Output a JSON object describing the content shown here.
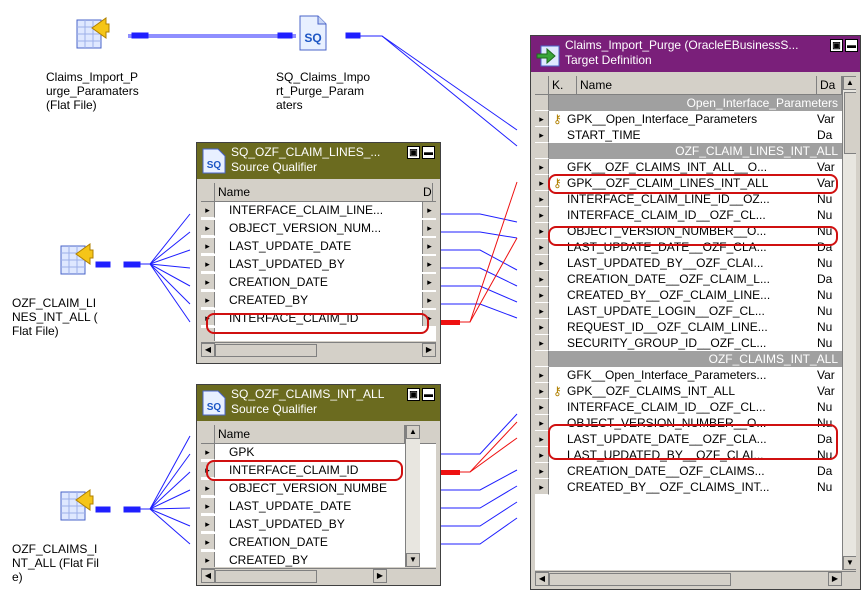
{
  "sources": [
    {
      "label": "Claims_Import_P\nurge_Paramaters\n(Flat File)"
    },
    {
      "label": "OZF_CLAIM_LI\nNES_INT_ALL (\nFlat File)"
    },
    {
      "label": "OZF_CLAIMS_I\nNT_ALL (Flat Fil\ne)"
    }
  ],
  "sq_params": {
    "label": "SQ_Claims_Impo\nrt_Purge_Param\naters",
    "icon": "SQ"
  },
  "sq_lines": {
    "title": "SQ_OZF_CLAIM_LINES_...",
    "subtitle": "Source Qualifier",
    "col_name": "Name",
    "col_type": "D",
    "rows": [
      {
        "name": "INTERFACE_CLAIM_LINE...",
        "type": "d"
      },
      {
        "name": "OBJECT_VERSION_NUM...",
        "type": "d"
      },
      {
        "name": "LAST_UPDATE_DATE",
        "type": "d"
      },
      {
        "name": "LAST_UPDATED_BY",
        "type": "d"
      },
      {
        "name": "CREATION_DATE",
        "type": "d"
      },
      {
        "name": "CREATED_BY",
        "type": "d"
      },
      {
        "name": "INTERFACE_CLAIM_ID",
        "type": "d"
      }
    ]
  },
  "sq_claims": {
    "title": "SQ_OZF_CLAIMS_INT_ALL",
    "subtitle": "Source Qualifier",
    "col_name": "Name",
    "rows": [
      {
        "name": "GPK"
      },
      {
        "name": "INTERFACE_CLAIM_ID"
      },
      {
        "name": "OBJECT_VERSION_NUMBE"
      },
      {
        "name": "LAST_UPDATE_DATE"
      },
      {
        "name": "LAST_UPDATED_BY"
      },
      {
        "name": "CREATION_DATE"
      },
      {
        "name": "CREATED_BY"
      }
    ]
  },
  "target": {
    "title": "Claims_Import_Purge (OracleEBusinessS...",
    "subtitle": "Target Definition",
    "col_k": "K.",
    "col_name": "Name",
    "col_type": "Da",
    "rows": [
      {
        "group": "Open_Interface_Parameters"
      },
      {
        "key": "key",
        "name": "GPK__Open_Interface_Parameters",
        "type": "Var"
      },
      {
        "name": "START_TIME",
        "type": "Da"
      },
      {
        "group": "OZF_CLAIM_LINES_INT_ALL"
      },
      {
        "name": "GFK__OZF_CLAIMS_INT_ALL__O...",
        "type": "Var"
      },
      {
        "key": "key",
        "name": "GPK__OZF_CLAIM_LINES_INT_ALL",
        "type": "Var"
      },
      {
        "name": "INTERFACE_CLAIM_LINE_ID__OZ...",
        "type": "Nu"
      },
      {
        "name": "INTERFACE_CLAIM_ID__OZF_CL...",
        "type": "Nu"
      },
      {
        "name": "OBJECT_VERSION_NUMBER__O...",
        "type": "Nu"
      },
      {
        "name": "LAST_UPDATE_DATE__OZF_CLA...",
        "type": "Da"
      },
      {
        "name": "LAST_UPDATED_BY__OZF_CLAI...",
        "type": "Nu"
      },
      {
        "name": "CREATION_DATE__OZF_CLAIM_L...",
        "type": "Da"
      },
      {
        "name": "CREATED_BY__OZF_CLAIM_LINE...",
        "type": "Nu"
      },
      {
        "name": "LAST_UPDATE_LOGIN__OZF_CL...",
        "type": "Nu"
      },
      {
        "name": "REQUEST_ID__OZF_CLAIM_LINE...",
        "type": "Nu"
      },
      {
        "name": "SECURITY_GROUP_ID__OZF_CL...",
        "type": "Nu"
      },
      {
        "group": "OZF_CLAIMS_INT_ALL"
      },
      {
        "name": "GFK__Open_Interface_Parameters...",
        "type": "Var"
      },
      {
        "key": "key",
        "name": "GPK__OZF_CLAIMS_INT_ALL",
        "type": "Var"
      },
      {
        "name": "INTERFACE_CLAIM_ID__OZF_CL...",
        "type": "Nu"
      },
      {
        "name": "OBJECT_VERSION_NUMBER__O...",
        "type": "Nu"
      },
      {
        "name": "LAST_UPDATE_DATE__OZF_CLA...",
        "type": "Da"
      },
      {
        "name": "LAST_UPDATED_BY__OZF_CLAI...",
        "type": "Nu"
      },
      {
        "name": "CREATION_DATE__OZF_CLAIMS...",
        "type": "Da"
      },
      {
        "name": "CREATED_BY__OZF_CLAIMS_INT...",
        "type": "Nu"
      }
    ]
  },
  "colors": {
    "link_blue": "#1f1fff",
    "link_red": "#ee1111",
    "highlight": "#d01010"
  }
}
